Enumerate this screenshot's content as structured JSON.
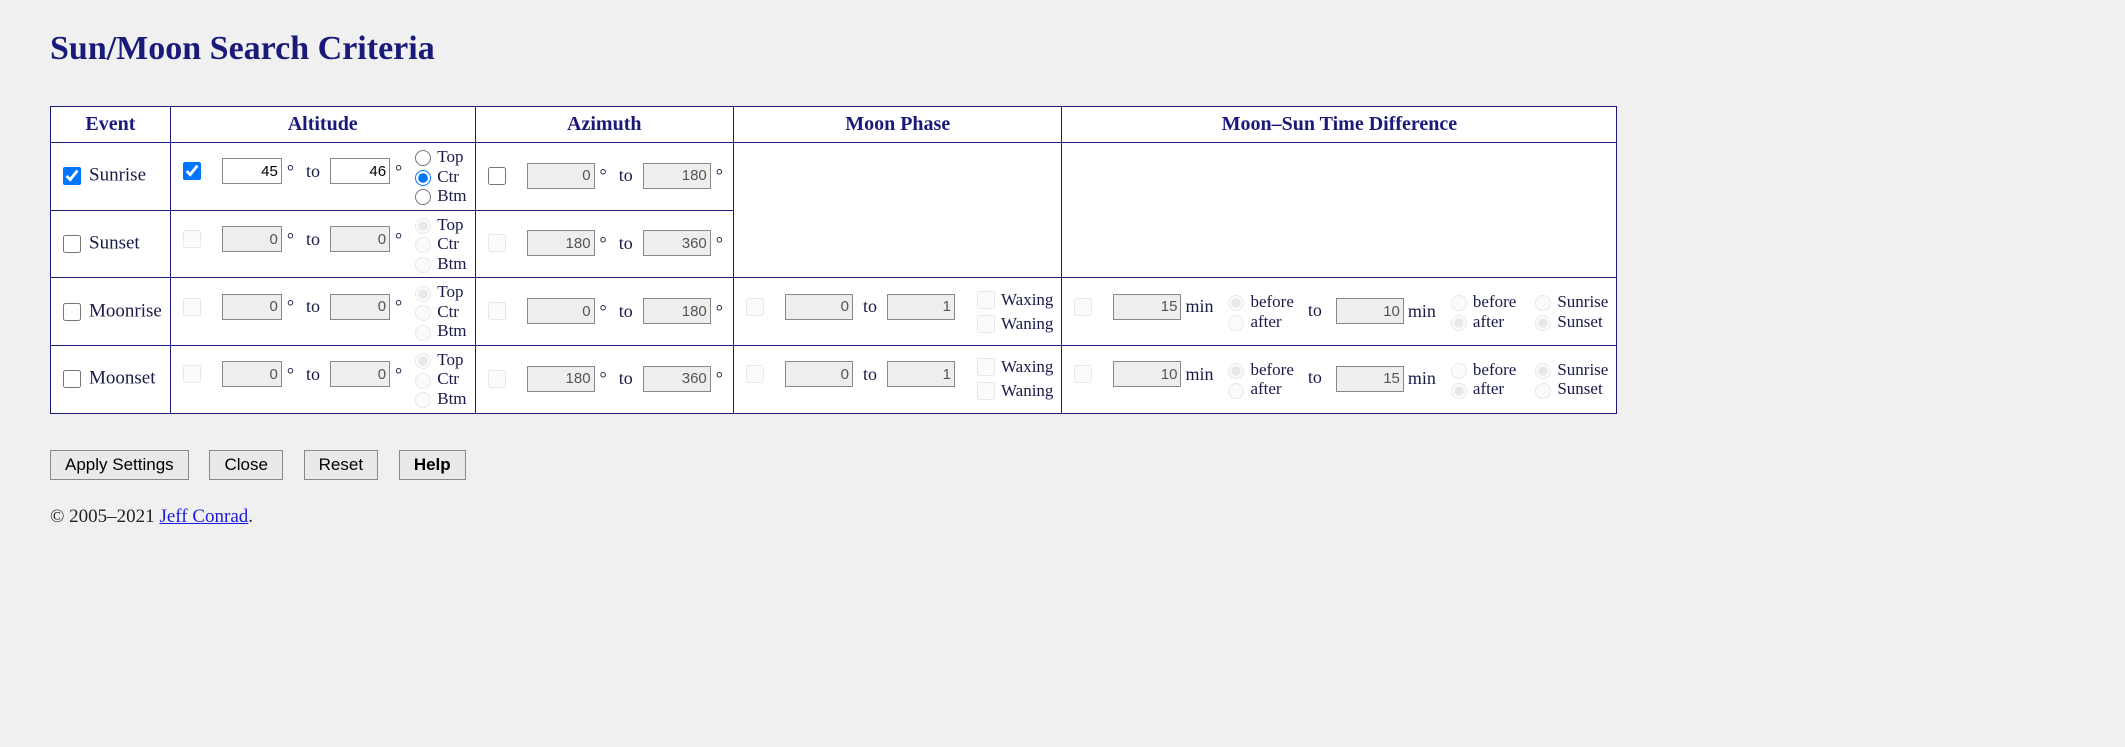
{
  "title": "Sun/Moon Search Criteria",
  "headers": {
    "event": "Event",
    "altitude": "Altitude",
    "azimuth": "Azimuth",
    "moonphase": "Moon Phase",
    "timediff": "Moon–Sun Time Difference"
  },
  "labels": {
    "to": "to",
    "deg": "°",
    "min": "min",
    "top": "Top",
    "ctr": "Ctr",
    "btm": "Btm",
    "waxing": "Waxing",
    "waning": "Waning",
    "before": "before",
    "after": "after",
    "sunrise": "Sunrise",
    "sunset": "Sunset"
  },
  "rows": {
    "sunrise": {
      "label": "Sunrise",
      "enabled": true,
      "altitude": {
        "enabled": true,
        "lo": "45",
        "hi": "46",
        "limb": "ctr"
      },
      "azimuth": {
        "enabled": false,
        "lo": "0",
        "hi": "180"
      }
    },
    "sunset": {
      "label": "Sunset",
      "enabled": false,
      "altitude": {
        "enabled": false,
        "lo": "0",
        "hi": "0",
        "limb": "top"
      },
      "azimuth": {
        "enabled": false,
        "lo": "180",
        "hi": "360"
      }
    },
    "moonrise": {
      "label": "Moonrise",
      "enabled": false,
      "altitude": {
        "enabled": false,
        "lo": "0",
        "hi": "0",
        "limb": "top"
      },
      "azimuth": {
        "enabled": false,
        "lo": "0",
        "hi": "180"
      },
      "phase": {
        "enabled": false,
        "lo": "0",
        "hi": "1",
        "waxing": false,
        "waning": false
      },
      "timediff": {
        "enabled": false,
        "lo": "15",
        "lo_rel": "before",
        "hi": "10",
        "hi_rel": "after",
        "ref": "sunset"
      }
    },
    "moonset": {
      "label": "Moonset",
      "enabled": false,
      "altitude": {
        "enabled": false,
        "lo": "0",
        "hi": "0",
        "limb": "top"
      },
      "azimuth": {
        "enabled": false,
        "lo": "180",
        "hi": "360"
      },
      "phase": {
        "enabled": false,
        "lo": "0",
        "hi": "1",
        "waxing": false,
        "waning": false
      },
      "timediff": {
        "enabled": false,
        "lo": "10",
        "lo_rel": "before",
        "hi": "15",
        "hi_rel": "after",
        "ref": "sunrise"
      }
    }
  },
  "buttons": {
    "apply": "Apply Settings",
    "close": "Close",
    "reset": "Reset",
    "help": "Help"
  },
  "copyright": {
    "prefix": "© 2005–2021 ",
    "link": "Jeff Conrad",
    "suffix": "."
  }
}
